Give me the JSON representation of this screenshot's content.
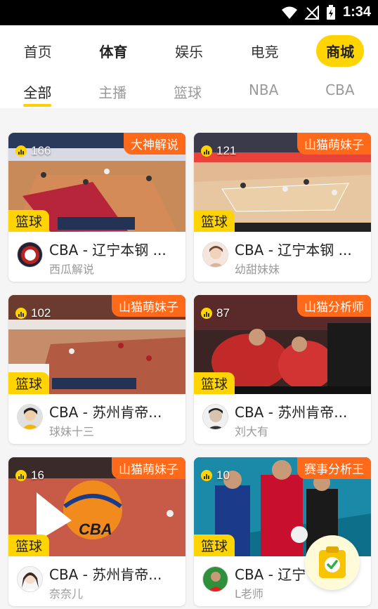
{
  "status_bar": {
    "time": "1:34"
  },
  "top_tabs": [
    {
      "label": "首页"
    },
    {
      "label": "体育"
    },
    {
      "label": "娱乐"
    },
    {
      "label": "电竞"
    },
    {
      "label": "商城"
    }
  ],
  "sub_tabs": [
    {
      "label": "全部"
    },
    {
      "label": "主播"
    },
    {
      "label": "篮球"
    },
    {
      "label": "NBA"
    },
    {
      "label": "CBA"
    }
  ],
  "cards": [
    {
      "viewers": "166",
      "badge": "大神解说",
      "tag": "篮球",
      "title": "CBA - 辽宁本钢 ...",
      "author": "西瓜解说"
    },
    {
      "viewers": "121",
      "badge": "山猫萌妹子",
      "tag": "篮球",
      "title": "CBA - 辽宁本钢 ...",
      "author": "幼甜妹妹"
    },
    {
      "viewers": "102",
      "badge": "山猫萌妹子",
      "tag": "篮球",
      "title": "CBA - 苏州肯帝...",
      "author": "球妹十三"
    },
    {
      "viewers": "87",
      "badge": "山猫分析师",
      "tag": "篮球",
      "title": "CBA - 苏州肯帝...",
      "author": "刘大有"
    },
    {
      "viewers": "16",
      "badge": "山猫萌妹子",
      "tag": "篮球",
      "title": "CBA - 苏州肯帝...",
      "author": "奈奈儿"
    },
    {
      "viewers": "10",
      "badge": "赛事分析王",
      "tag": "篮球",
      "title": "CBA - 辽宁",
      "author": "L老师"
    }
  ],
  "colors": {
    "accent": "#ffd400",
    "badge": "#ff6a1a"
  }
}
